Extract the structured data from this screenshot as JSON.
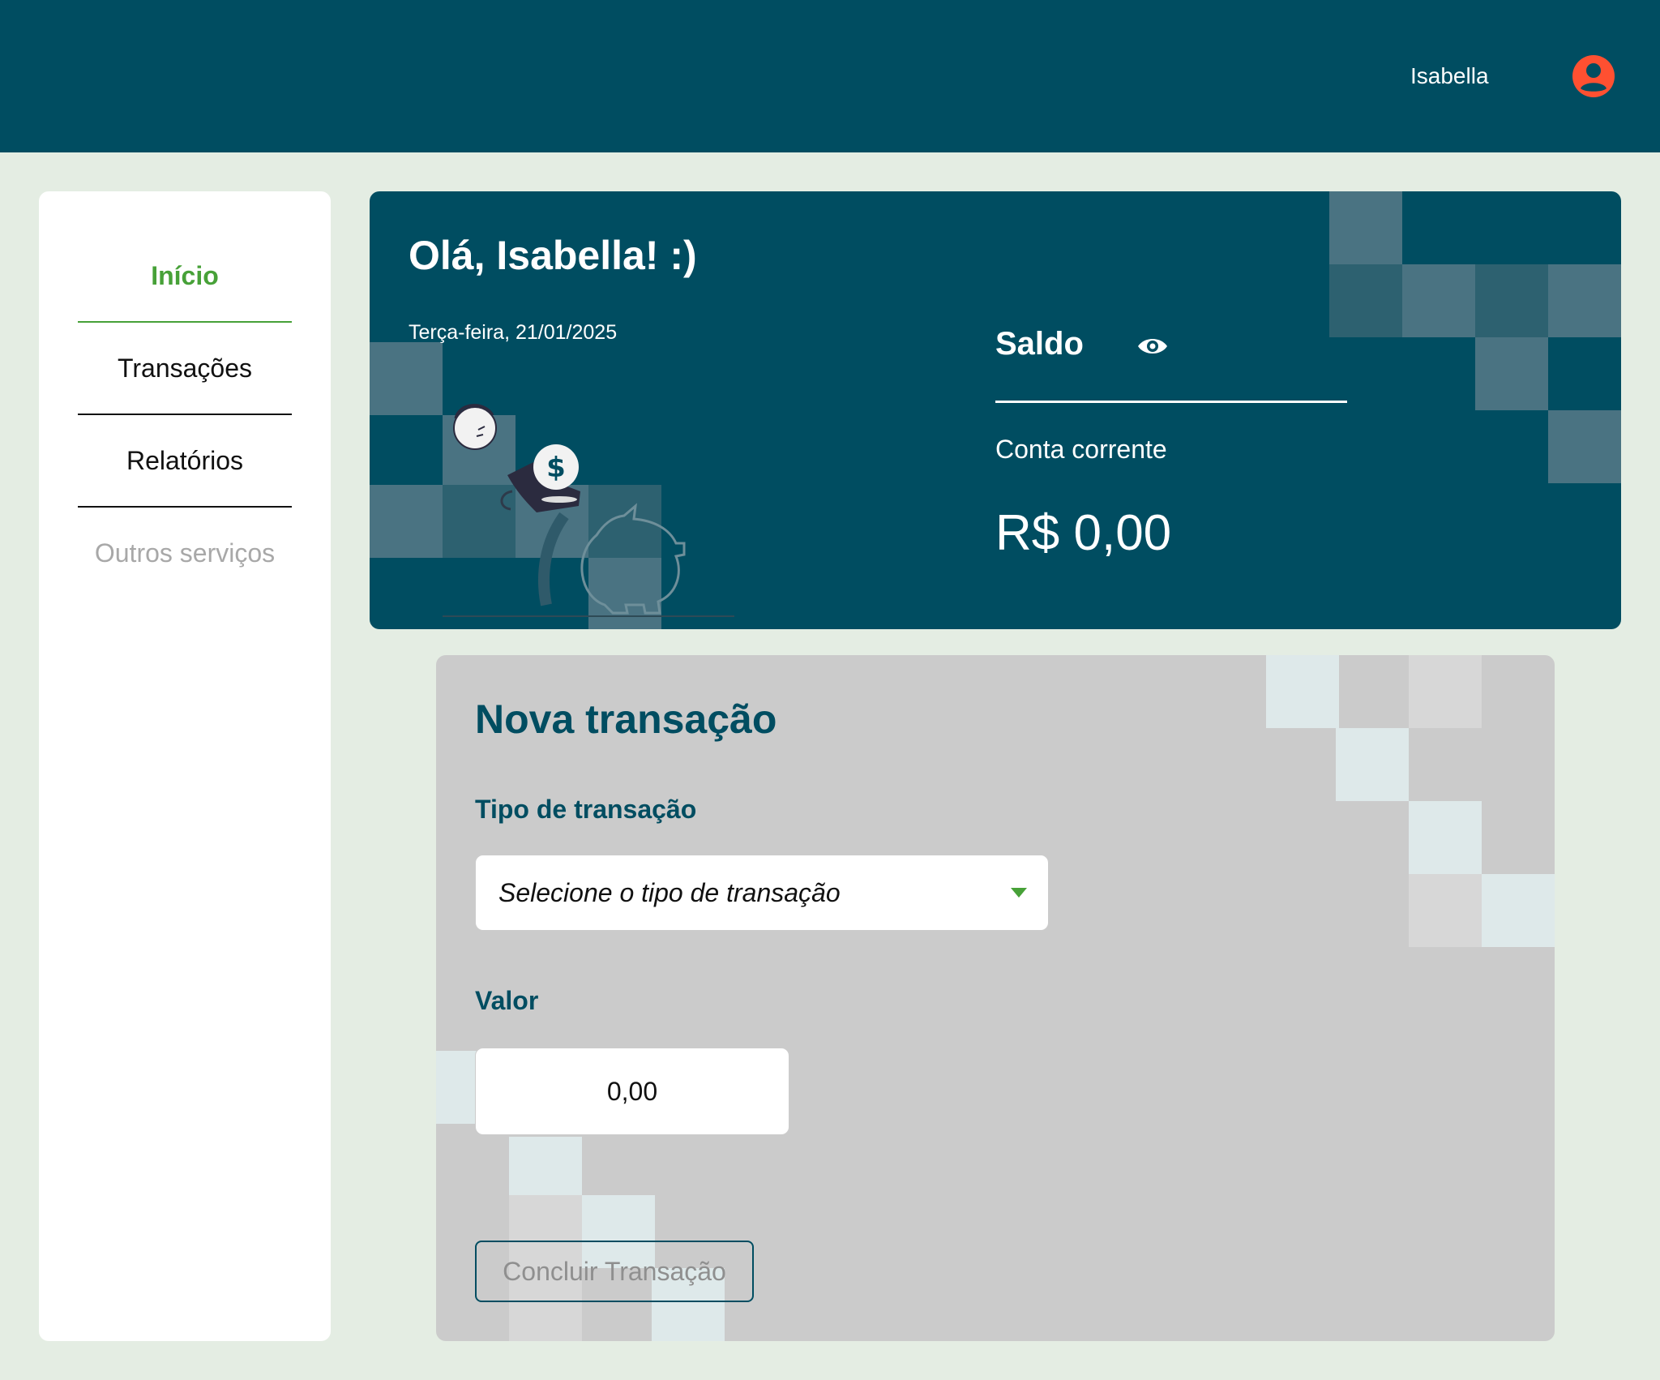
{
  "header": {
    "user_name": "Isabella",
    "avatar_icon": "user-circle-icon",
    "accent_color": "#FF5031"
  },
  "sidebar": {
    "items": [
      {
        "label": "Início",
        "state": "active"
      },
      {
        "label": "Transações",
        "state": "normal"
      },
      {
        "label": "Relatórios",
        "state": "normal"
      },
      {
        "label": "Outros serviços",
        "state": "disabled"
      }
    ]
  },
  "balance": {
    "greeting": "Olá, Isabella! :)",
    "date": "Terça-feira, 21/01/2025",
    "saldo_label": "Saldo",
    "visibility_icon": "eye-icon",
    "account_label": "Conta corrente",
    "account_value": "R$ 0,00",
    "illustration": "person-with-piggy-bank-illustration"
  },
  "transaction": {
    "title": "Nova transação",
    "type_label": "Tipo de transação",
    "type_placeholder": "Selecione o tipo de transação",
    "value_label": "Valor",
    "value": "0,00",
    "submit_label": "Concluir Transação"
  },
  "colors": {
    "primary": "#004D61",
    "green": "#47A138",
    "background": "#E4EDE3",
    "card_gray": "#CBCBCB"
  }
}
